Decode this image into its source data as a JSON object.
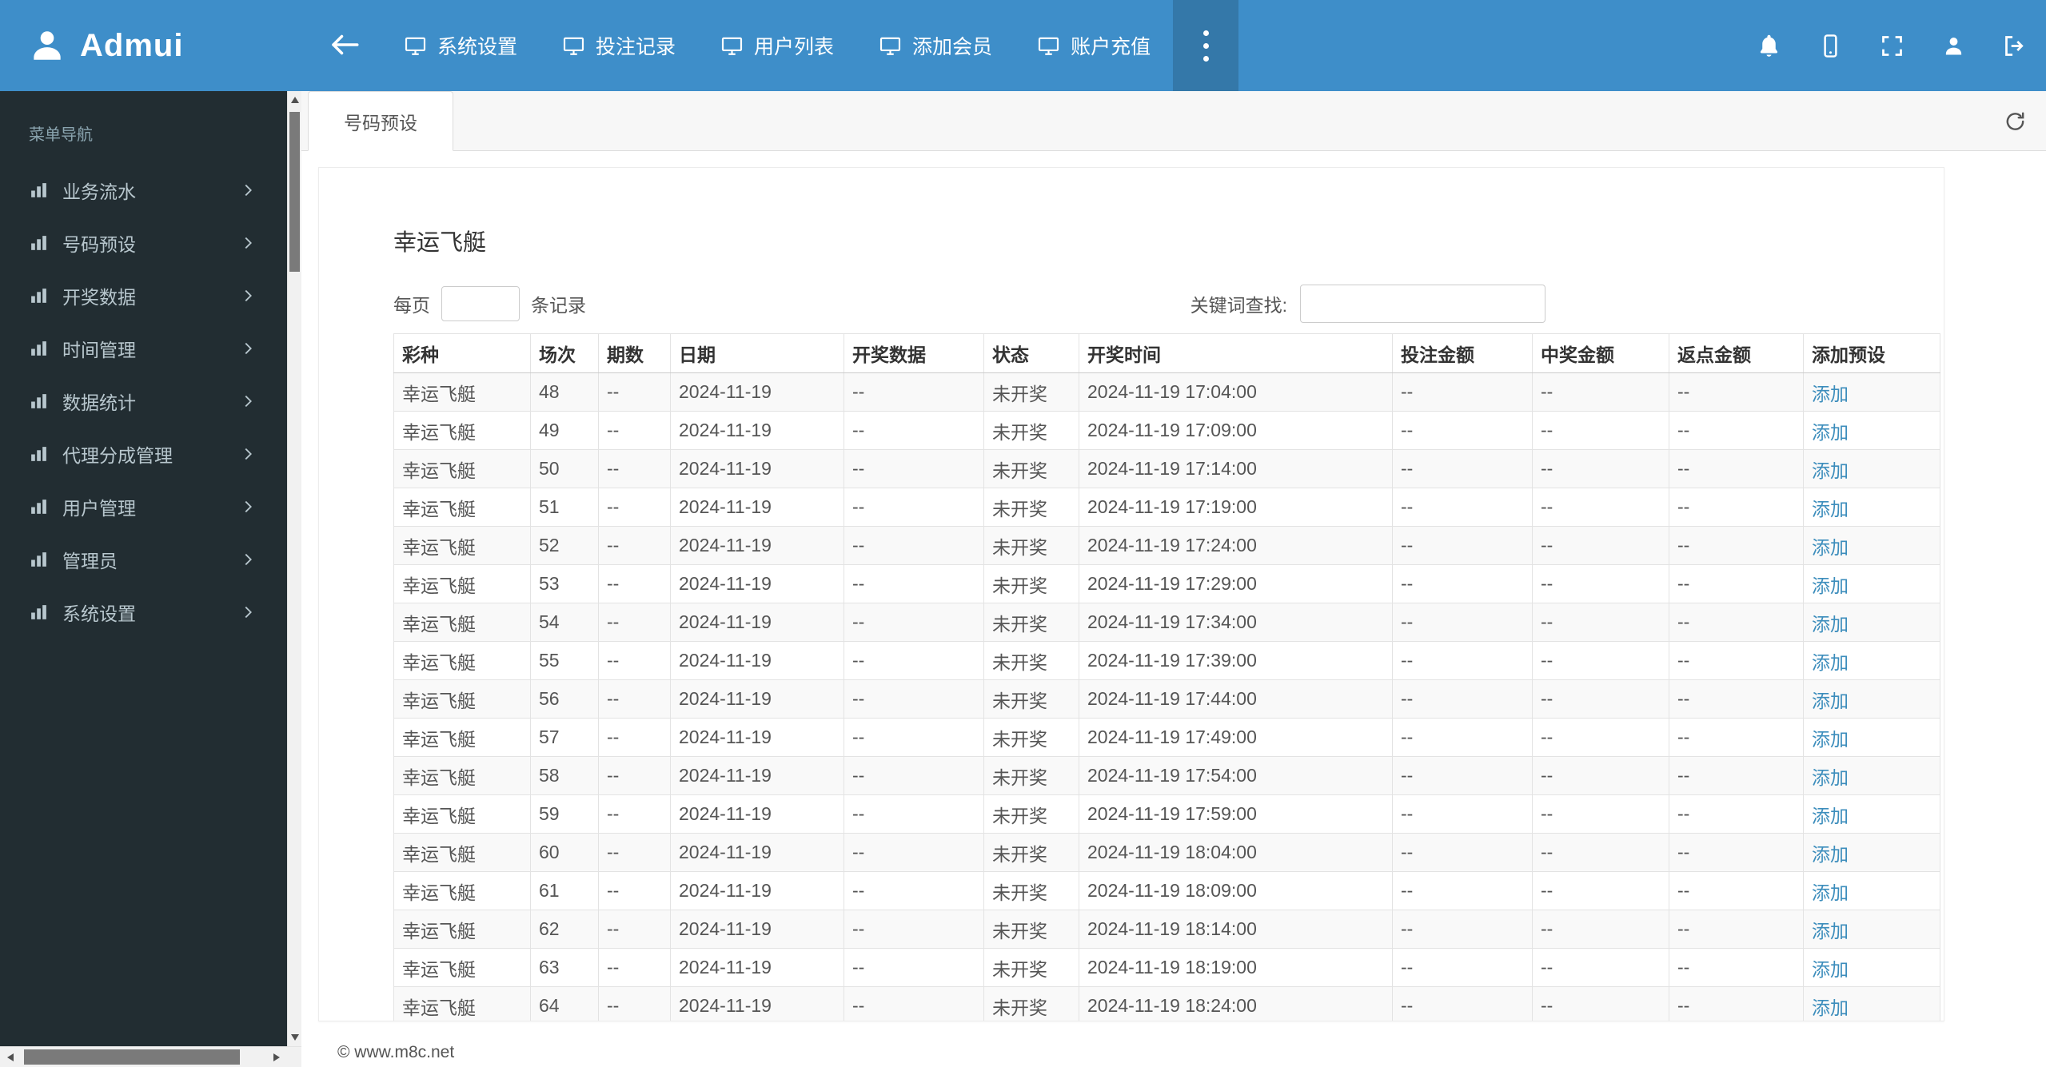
{
  "colors": {
    "navbar": "#3e8ec9",
    "navbar_active_item": "#3478a9",
    "sidebar": "#222d32",
    "sidebar_text": "#b8c7ce",
    "link": "#3c8dbc"
  },
  "navbar": {
    "brand": "Admui",
    "menu": [
      "系统设置",
      "投注记录",
      "用户列表",
      "添加会员",
      "账户充值"
    ],
    "right_icons": [
      "bell",
      "mobile",
      "fullscreen",
      "user",
      "logout"
    ]
  },
  "sidebar": {
    "header": "菜单导航",
    "items": [
      "业务流水",
      "号码预设",
      "开奖数据",
      "时间管理",
      "数据统计",
      "代理分成管理",
      "用户管理",
      "管理员",
      "系统设置"
    ]
  },
  "tabbar": {
    "active_tab": "号码预设"
  },
  "page": {
    "title": "幸运飞艇",
    "per_page_prefix": "每页",
    "per_page_suffix": "条记录",
    "per_page_value": "",
    "search_label": "关键词查找:",
    "search_value": ""
  },
  "table": {
    "headers": [
      "彩种",
      "场次",
      "期数",
      "日期",
      "开奖数据",
      "状态",
      "开奖时间",
      "投注金额",
      "中奖金额",
      "返点金额",
      "添加预设"
    ],
    "rows": [
      [
        "幸运飞艇",
        "48",
        "--",
        "2024-11-19",
        "--",
        "未开奖",
        "2024-11-19 17:04:00",
        "--",
        "--",
        "--",
        "添加"
      ],
      [
        "幸运飞艇",
        "49",
        "--",
        "2024-11-19",
        "--",
        "未开奖",
        "2024-11-19 17:09:00",
        "--",
        "--",
        "--",
        "添加"
      ],
      [
        "幸运飞艇",
        "50",
        "--",
        "2024-11-19",
        "--",
        "未开奖",
        "2024-11-19 17:14:00",
        "--",
        "--",
        "--",
        "添加"
      ],
      [
        "幸运飞艇",
        "51",
        "--",
        "2024-11-19",
        "--",
        "未开奖",
        "2024-11-19 17:19:00",
        "--",
        "--",
        "--",
        "添加"
      ],
      [
        "幸运飞艇",
        "52",
        "--",
        "2024-11-19",
        "--",
        "未开奖",
        "2024-11-19 17:24:00",
        "--",
        "--",
        "--",
        "添加"
      ],
      [
        "幸运飞艇",
        "53",
        "--",
        "2024-11-19",
        "--",
        "未开奖",
        "2024-11-19 17:29:00",
        "--",
        "--",
        "--",
        "添加"
      ],
      [
        "幸运飞艇",
        "54",
        "--",
        "2024-11-19",
        "--",
        "未开奖",
        "2024-11-19 17:34:00",
        "--",
        "--",
        "--",
        "添加"
      ],
      [
        "幸运飞艇",
        "55",
        "--",
        "2024-11-19",
        "--",
        "未开奖",
        "2024-11-19 17:39:00",
        "--",
        "--",
        "--",
        "添加"
      ],
      [
        "幸运飞艇",
        "56",
        "--",
        "2024-11-19",
        "--",
        "未开奖",
        "2024-11-19 17:44:00",
        "--",
        "--",
        "--",
        "添加"
      ],
      [
        "幸运飞艇",
        "57",
        "--",
        "2024-11-19",
        "--",
        "未开奖",
        "2024-11-19 17:49:00",
        "--",
        "--",
        "--",
        "添加"
      ],
      [
        "幸运飞艇",
        "58",
        "--",
        "2024-11-19",
        "--",
        "未开奖",
        "2024-11-19 17:54:00",
        "--",
        "--",
        "--",
        "添加"
      ],
      [
        "幸运飞艇",
        "59",
        "--",
        "2024-11-19",
        "--",
        "未开奖",
        "2024-11-19 17:59:00",
        "--",
        "--",
        "--",
        "添加"
      ],
      [
        "幸运飞艇",
        "60",
        "--",
        "2024-11-19",
        "--",
        "未开奖",
        "2024-11-19 18:04:00",
        "--",
        "--",
        "--",
        "添加"
      ],
      [
        "幸运飞艇",
        "61",
        "--",
        "2024-11-19",
        "--",
        "未开奖",
        "2024-11-19 18:09:00",
        "--",
        "--",
        "--",
        "添加"
      ],
      [
        "幸运飞艇",
        "62",
        "--",
        "2024-11-19",
        "--",
        "未开奖",
        "2024-11-19 18:14:00",
        "--",
        "--",
        "--",
        "添加"
      ],
      [
        "幸运飞艇",
        "63",
        "--",
        "2024-11-19",
        "--",
        "未开奖",
        "2024-11-19 18:19:00",
        "--",
        "--",
        "--",
        "添加"
      ],
      [
        "幸运飞艇",
        "64",
        "--",
        "2024-11-19",
        "--",
        "未开奖",
        "2024-11-19 18:24:00",
        "--",
        "--",
        "--",
        "添加"
      ]
    ]
  },
  "footer": {
    "copyright": "© www.m8c.net"
  }
}
